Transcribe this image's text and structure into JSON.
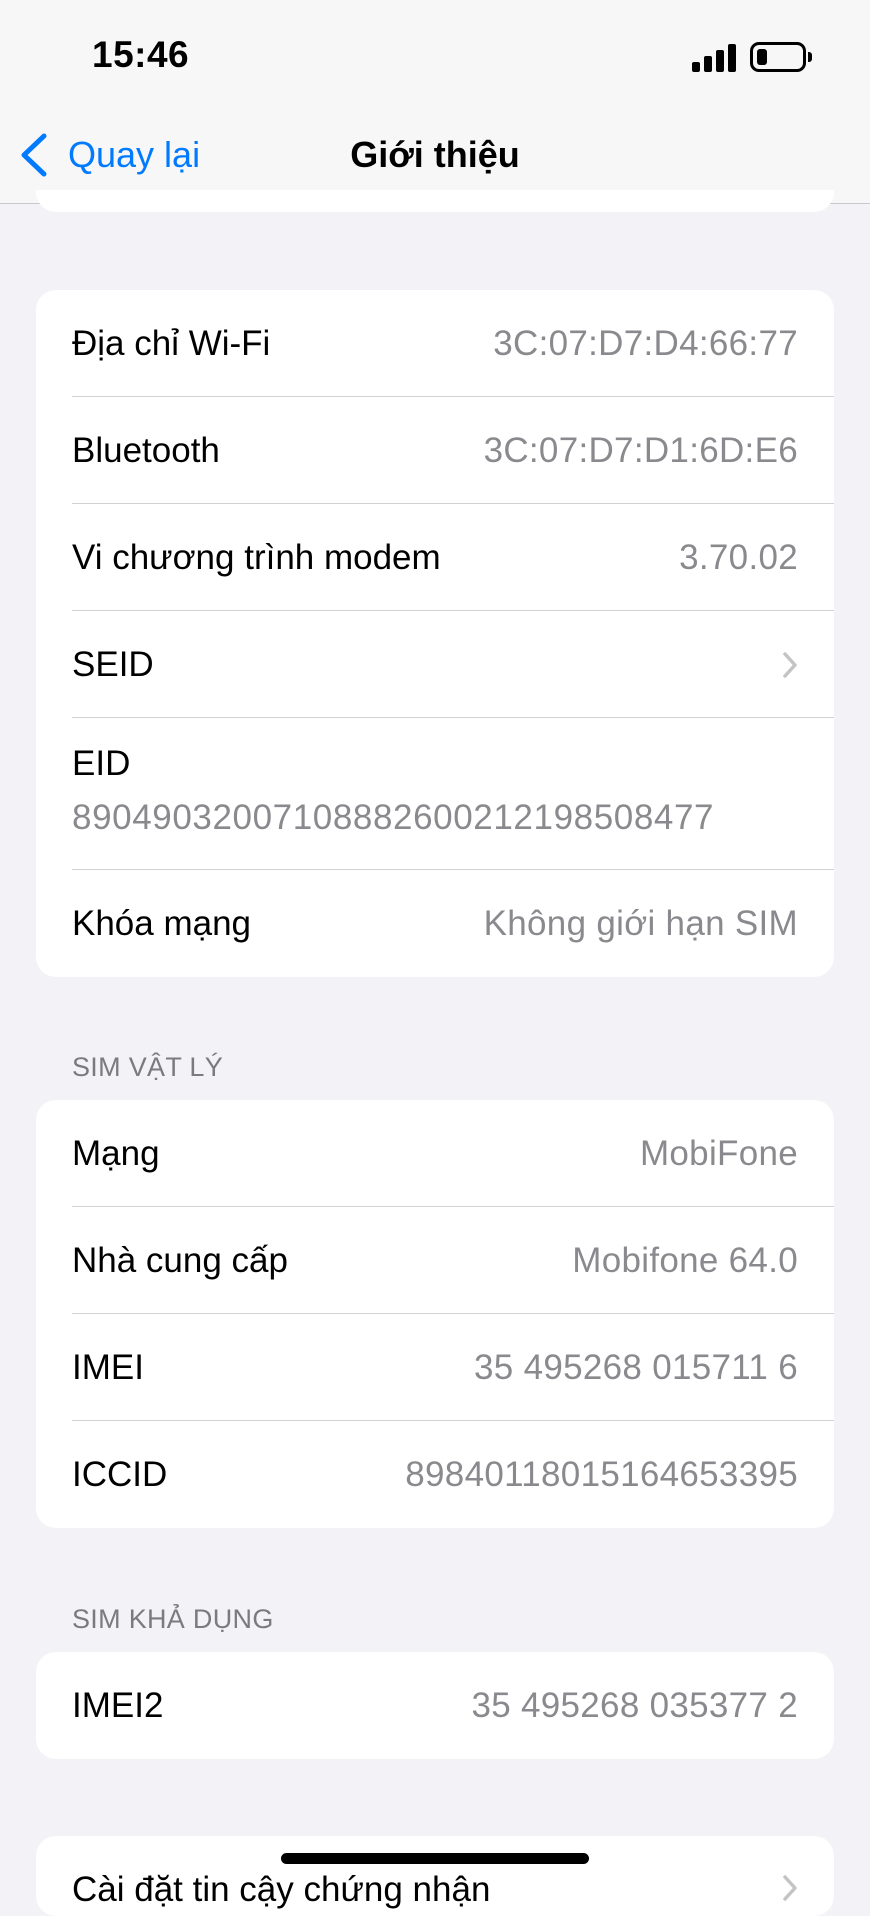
{
  "status_bar": {
    "time": "15:46"
  },
  "nav": {
    "back_label": "Quay lại",
    "title": "Giới thiệu"
  },
  "network_group": {
    "rows": [
      {
        "label": "Địa chỉ Wi-Fi",
        "value": "3C:07:D7:D4:66:77"
      },
      {
        "label": "Bluetooth",
        "value": "3C:07:D7:D1:6D:E6"
      },
      {
        "label": "Vi chương trình modem",
        "value": "3.70.02"
      },
      {
        "label": "SEID"
      },
      {
        "label": "EID",
        "value": "89049032007108882600212198508477"
      },
      {
        "label": "Khóa mạng",
        "value": "Không giới hạn SIM"
      }
    ]
  },
  "physical_sim": {
    "header": "SIM VẬT LÝ",
    "rows": [
      {
        "label": "Mạng",
        "value": "MobiFone"
      },
      {
        "label": "Nhà cung cấp",
        "value": "Mobifone 64.0"
      },
      {
        "label": "IMEI",
        "value": "35 495268 015711 6"
      },
      {
        "label": "ICCID",
        "value": "89840118015164653395"
      }
    ]
  },
  "available_sim": {
    "header": "SIM KHẢ DỤNG",
    "rows": [
      {
        "label": "IMEI2",
        "value": "35 495268 035377 2"
      }
    ]
  },
  "next_group": {
    "label": "Cài đặt tin cậy chứng nhận"
  },
  "colors": {
    "accent": "#007aff",
    "secondary_text": "#8a8a8e",
    "background": "#f2f2f7"
  }
}
